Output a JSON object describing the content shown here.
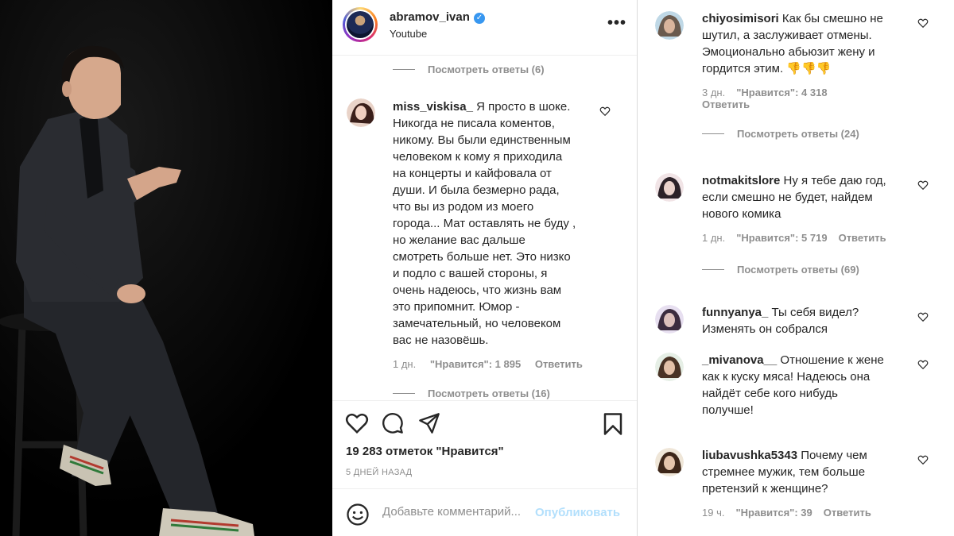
{
  "post": {
    "username": "abramov_ivan",
    "location": "Youtube",
    "more_icon": "more-horizontal-icon",
    "view_replies_top": "Посмотреть ответы (6)",
    "comment_main": {
      "username": "miss_viskisa_",
      "text": "Я просто в шоке. Никогда не писала коментов, никому. Вы были единственным человеком к кому я приходила на концерты и кайфовала от души. И была безмерно рада, что вы из родом из моего города... Мат оставлять не буду , но желание вас дальше смотреть больше нет. Это низко и подло с вашей стороны, я очень надеюсь, что жизнь вам это припомнит. Юмор - замечательный, но человеком вас не назовёшь.",
      "lines": [
        "Я просто в шоке.",
        "Никогда не писала коментов,",
        "никому. Вы были единственным",
        "человеком к кому я приходила",
        "на концерты и кайфовала от",
        "души. И была безмерно рада,",
        "что вы из родом из моего",
        "города... Мат оставлять не буду ,",
        "но желание вас дальше",
        "смотреть больше нет. Это низко",
        "и подло с вашей стороны, я",
        "очень надеюсь, что жизнь вам",
        "это припомнит. Юмор -",
        "замечательный, но человеком",
        "вас не назовёшь."
      ],
      "age": "1 дн.",
      "likes": "\"Нравится\": 1 895",
      "reply": "Ответить"
    },
    "view_replies_bottom": "Посмотреть ответы (16)",
    "likes_total": "19 283 отметок \"Нравится\"",
    "posted": "5 ДНЕЙ НАЗАД",
    "comment_placeholder": "Добавьте комментарий...",
    "publish": "Опубликовать"
  },
  "right_comments": [
    {
      "username": "chiyosimisori",
      "lines": [
        "Как бы смешно не",
        "шутил, а заслуживает отмены.",
        "Эмоционально абьюзит жену и",
        "гордится этим. 👎👎👎"
      ],
      "age": "3 дн.",
      "likes": "\"Нравится\": 4 318",
      "reply": "Ответить",
      "replies": "Посмотреть ответы (24)"
    },
    {
      "username": "notmakitslore",
      "lines": [
        "Ну я тебе даю год,",
        "если смешно не будет, найдем",
        "нового комика"
      ],
      "age": "1 дн.",
      "likes": "\"Нравится\": 5 719",
      "reply": "Ответить",
      "replies": "Посмотреть ответы (69)"
    },
    {
      "username": "funnyanya_",
      "lines": [
        "Ты себя видел?",
        "Изменять он собрался"
      ]
    },
    {
      "username": "_mivanova__",
      "lines": [
        "Отношение к жене",
        "как к куску мяса! Надеюсь она",
        "найдёт себе кого нибудь",
        "получше!"
      ]
    },
    {
      "username": "liubavushka5343",
      "lines": [
        "Почему чем",
        "стремнее мужик, тем больше",
        "претензий к женщине?"
      ],
      "age": "19 ч.",
      "likes": "\"Нравится\": 39",
      "reply": "Ответить"
    }
  ],
  "colors": {
    "text": "#262626",
    "muted": "#8e8e8e",
    "verified": "#3897f0",
    "publish_disabled": "#b2dffc",
    "border": "#dbdbdb"
  }
}
